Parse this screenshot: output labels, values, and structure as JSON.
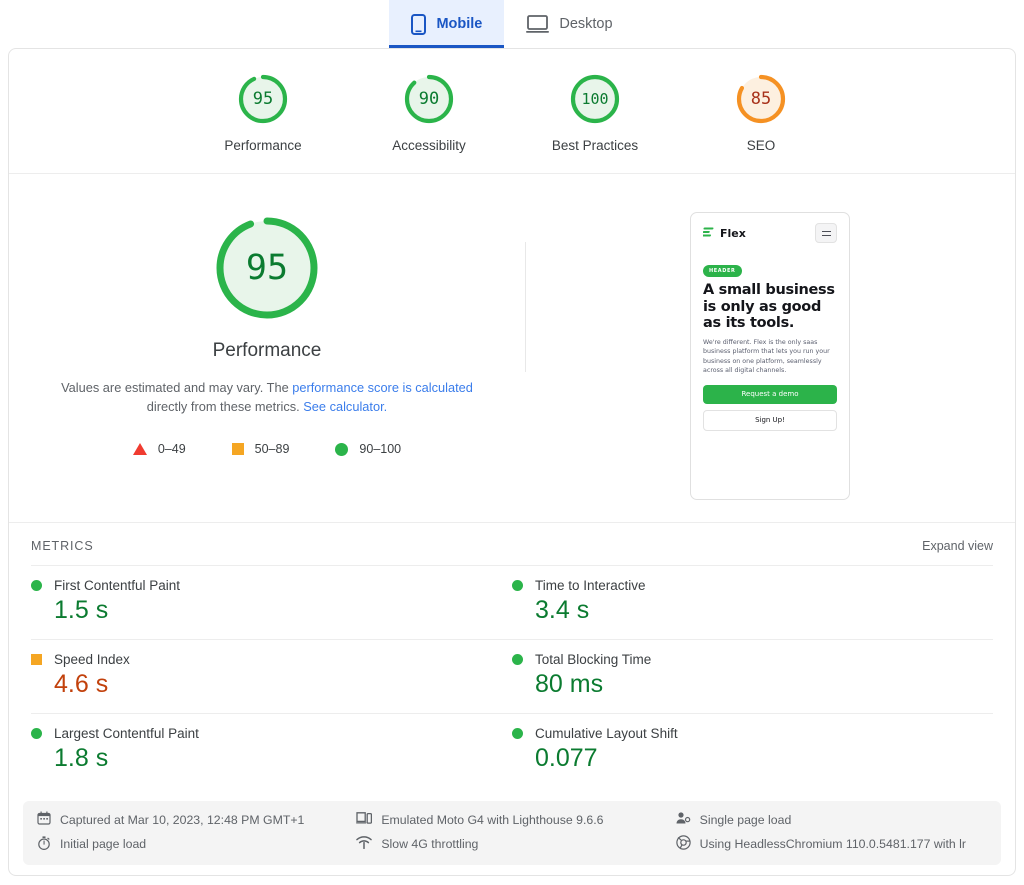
{
  "tabs": [
    {
      "label": "Mobile",
      "icon": "phone-icon",
      "active": true
    },
    {
      "label": "Desktop",
      "icon": "desktop-icon",
      "active": false
    }
  ],
  "category_scores": [
    {
      "label": "Performance",
      "value": "95",
      "pct": 95,
      "tone": "pass"
    },
    {
      "label": "Accessibility",
      "value": "90",
      "pct": 90,
      "tone": "pass"
    },
    {
      "label": "Best Practices",
      "value": "100",
      "pct": 100,
      "tone": "pass"
    },
    {
      "label": "SEO",
      "value": "85",
      "pct": 85,
      "tone": "average"
    }
  ],
  "performance": {
    "score": "95",
    "pct": 95,
    "title": "Performance",
    "desc_part1": "Values are estimated and may vary. The ",
    "desc_link1": "performance score is calculated",
    "desc_part2": " directly from these metrics. ",
    "desc_link2": "See calculator.",
    "legend": [
      {
        "shape": "triangle",
        "label": "0–49",
        "color": "#f03b30"
      },
      {
        "shape": "square",
        "label": "50–89",
        "color": "#f5a623"
      },
      {
        "shape": "circle",
        "label": "90–100",
        "color": "#2bb44a"
      }
    ]
  },
  "thumbnail": {
    "brand": "Flex",
    "menu_icon": "hamburger-icon",
    "badge": "HEADER",
    "headline": "A small business is only as good as its tools.",
    "body": "We're different. Flex is the only saas business platform that lets you run your business on one platform, seamlessly across all digital channels.",
    "primary_cta": "Request a demo",
    "secondary_cta": "Sign Up!"
  },
  "metrics_section": {
    "title": "METRICS",
    "expand_label": "Expand view",
    "items": [
      {
        "name": "First Contentful Paint",
        "value": "1.5 s",
        "marker": "circle",
        "marker_color": "#2bb44a",
        "value_color": "#0b7b30"
      },
      {
        "name": "Time to Interactive",
        "value": "3.4 s",
        "marker": "circle",
        "marker_color": "#2bb44a",
        "value_color": "#0b7b30"
      },
      {
        "name": "Speed Index",
        "value": "4.6 s",
        "marker": "square",
        "marker_color": "#f5a623",
        "value_color": "#c2410c"
      },
      {
        "name": "Total Blocking Time",
        "value": "80 ms",
        "marker": "circle",
        "marker_color": "#2bb44a",
        "value_color": "#0b7b30"
      },
      {
        "name": "Largest Contentful Paint",
        "value": "1.8 s",
        "marker": "circle",
        "marker_color": "#2bb44a",
        "value_color": "#0b7b30"
      },
      {
        "name": "Cumulative Layout Shift",
        "value": "0.077",
        "marker": "circle",
        "marker_color": "#2bb44a",
        "value_color": "#0b7b30"
      }
    ]
  },
  "meta": [
    {
      "icon": "calendar-icon",
      "text": "Captured at Mar 10, 2023, 12:48 PM GMT+1"
    },
    {
      "icon": "device-icon",
      "text": "Emulated Moto G4 with Lighthouse 9.6.6"
    },
    {
      "icon": "users-icon",
      "text": "Single page load"
    },
    {
      "icon": "stopwatch-icon",
      "text": "Initial page load"
    },
    {
      "icon": "wifi-icon",
      "text": "Slow 4G throttling"
    },
    {
      "icon": "chrome-icon",
      "text": "Using HeadlessChromium 110.0.5481.177 with lr"
    }
  ],
  "colors": {
    "pass": "#2bb44a",
    "average": "#f5a623",
    "fail": "#f03b30",
    "link": "#3b7deb",
    "tab_active": "#1a56c4"
  }
}
